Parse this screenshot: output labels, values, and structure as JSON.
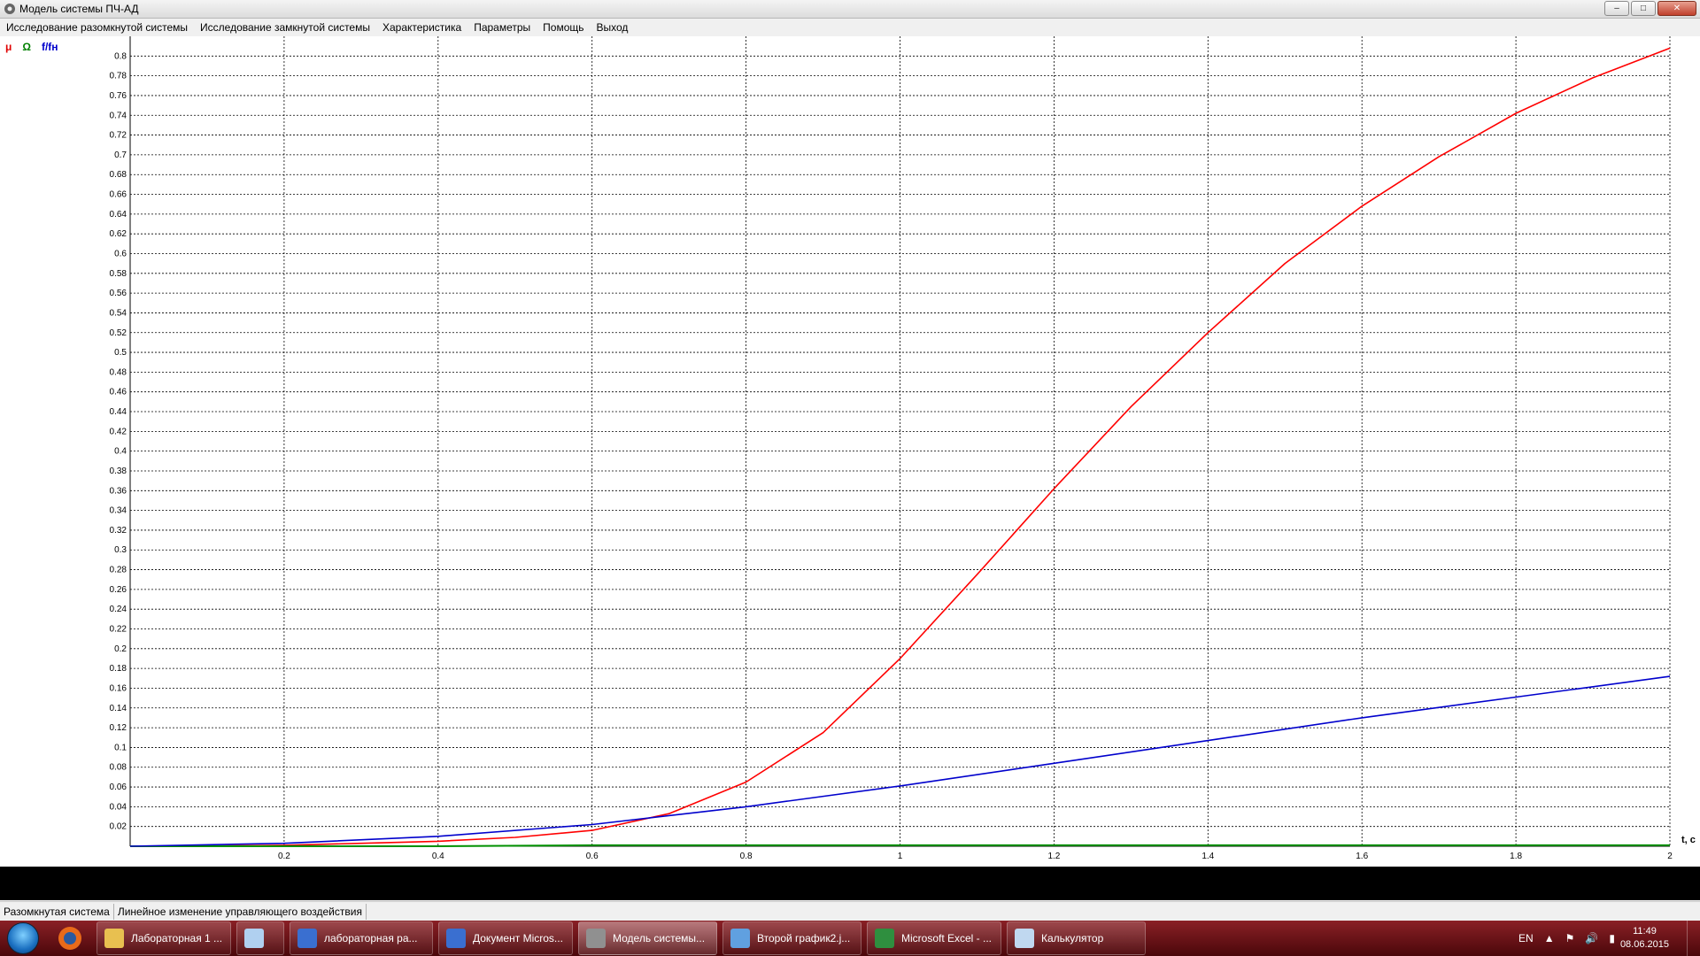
{
  "window": {
    "title": "Модель системы ПЧ-АД",
    "controls": [
      "–",
      "□",
      "✕"
    ]
  },
  "menu": [
    "Исследование разомкнутой системы",
    "Исследование замкнутой системы",
    "Характеристика",
    "Параметры",
    "Помощь",
    "Выход"
  ],
  "legend": [
    {
      "label": "μ",
      "color": "#e00000"
    },
    {
      "label": "Ω",
      "color": "#008000"
    },
    {
      "label": "f/fн",
      "color": "#0000cc"
    }
  ],
  "colors": {
    "mu": "#ff0000",
    "omega": "#009000",
    "f": "#0000cc"
  },
  "chart_data": {
    "type": "line",
    "xlabel": "t, c",
    "ylabel": "",
    "xlim": [
      0,
      2
    ],
    "ylim": [
      0,
      0.82
    ],
    "grid": true,
    "legend_position": "top-left",
    "x_ticks": [
      "0.2",
      "0.4",
      "0.6",
      "0.8",
      "1",
      "1.2",
      "1.4",
      "1.6",
      "1.8",
      "2"
    ],
    "y_ticks": [
      "0.02",
      "0.04",
      "0.06",
      "0.08",
      "0.1",
      "0.12",
      "0.14",
      "0.16",
      "0.18",
      "0.2",
      "0.22",
      "0.24",
      "0.26",
      "0.28",
      "0.3",
      "0.32",
      "0.34",
      "0.36",
      "0.38",
      "0.4",
      "0.42",
      "0.44",
      "0.46",
      "0.48",
      "0.5",
      "0.52",
      "0.54",
      "0.56",
      "0.58",
      "0.6",
      "0.62",
      "0.64",
      "0.66",
      "0.68",
      "0.7",
      "0.72",
      "0.74",
      "0.76",
      "0.78",
      "0.8"
    ],
    "series": [
      {
        "name": "μ",
        "color": "#ff0000",
        "x": [
          0,
          0.1,
          0.2,
          0.3,
          0.4,
          0.5,
          0.6,
          0.7,
          0.8,
          0.9,
          1.0,
          1.1,
          1.2,
          1.3,
          1.4,
          1.5,
          1.6,
          1.7,
          1.8,
          1.9,
          2.0
        ],
        "y": [
          0,
          0.0002,
          0.001,
          0.003,
          0.005,
          0.009,
          0.016,
          0.033,
          0.065,
          0.115,
          0.19,
          0.275,
          0.362,
          0.445,
          0.52,
          0.59,
          0.648,
          0.698,
          0.742,
          0.778,
          0.808
        ]
      },
      {
        "name": "Ω",
        "color": "#009000",
        "x": [
          0,
          0.2,
          0.4,
          0.6,
          0.8,
          1.0,
          1.2,
          1.4,
          1.6,
          1.8,
          2.0
        ],
        "y": [
          0,
          0,
          0,
          0.001,
          0.001,
          0.001,
          0.001,
          0.001,
          0.001,
          0.001,
          0.001
        ]
      },
      {
        "name": "f/fн",
        "color": "#0000cc",
        "x": [
          0,
          0.2,
          0.4,
          0.6,
          0.8,
          1.0,
          1.2,
          1.4,
          1.6,
          1.8,
          2.0
        ],
        "y": [
          0,
          0.003,
          0.01,
          0.022,
          0.04,
          0.061,
          0.084,
          0.107,
          0.13,
          0.151,
          0.172
        ]
      }
    ]
  },
  "status": [
    "Разомкнутая система",
    "Линейное изменение управляющего воздействия"
  ],
  "taskbar": {
    "items": [
      {
        "label": "Лабораторная 1 ...",
        "icon": "folder-icon",
        "color": "#e8c050"
      },
      {
        "label": "",
        "icon": "notepad-icon",
        "color": "#b0d0f0"
      },
      {
        "label": "лабораторная ра...",
        "icon": "word-icon",
        "color": "#3a6fd0"
      },
      {
        "label": "Документ Micros...",
        "icon": "word-icon",
        "color": "#3a6fd0"
      },
      {
        "label": "Модель системы...",
        "icon": "gear-icon",
        "color": "#909090"
      },
      {
        "label": "Второй график2.j...",
        "icon": "paint-icon",
        "color": "#60a0e0"
      },
      {
        "label": "Microsoft Excel - ...",
        "icon": "excel-icon",
        "color": "#2f8f3f"
      },
      {
        "label": "Калькулятор",
        "icon": "calculator-icon",
        "color": "#c0d8f0"
      }
    ],
    "lang": "EN",
    "time": "11:49",
    "date": "08.06.2015"
  }
}
